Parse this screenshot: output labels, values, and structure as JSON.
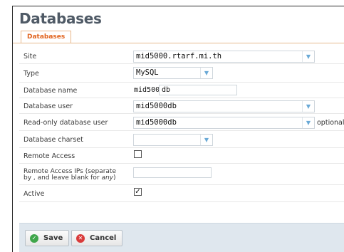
{
  "page": {
    "title": "Databases"
  },
  "tabs": [
    {
      "label": "Databases"
    }
  ],
  "form": {
    "site": {
      "label": "Site",
      "value": "mid5000.rtarf.mi.th"
    },
    "type": {
      "label": "Type",
      "value": "MySQL"
    },
    "database_name": {
      "label": "Database name",
      "prefix": "mid5000",
      "value": "db"
    },
    "database_user": {
      "label": "Database user",
      "value": "mid5000db"
    },
    "readonly_user": {
      "label": "Read-only database user",
      "value": "mid5000db",
      "suffix": "optional"
    },
    "charset": {
      "label": "Database charset",
      "value": ""
    },
    "remote_access": {
      "label": "Remote Access",
      "checked": false
    },
    "remote_ips": {
      "label_line1": "Remote Access IPs (separate",
      "label_line2a": "by , and leave blank for ",
      "label_line2b": "any",
      "label_line2c": ")",
      "value": ""
    },
    "active": {
      "label": "Active",
      "checked": true
    }
  },
  "buttons": {
    "save": "Save",
    "cancel": "Cancel"
  }
}
